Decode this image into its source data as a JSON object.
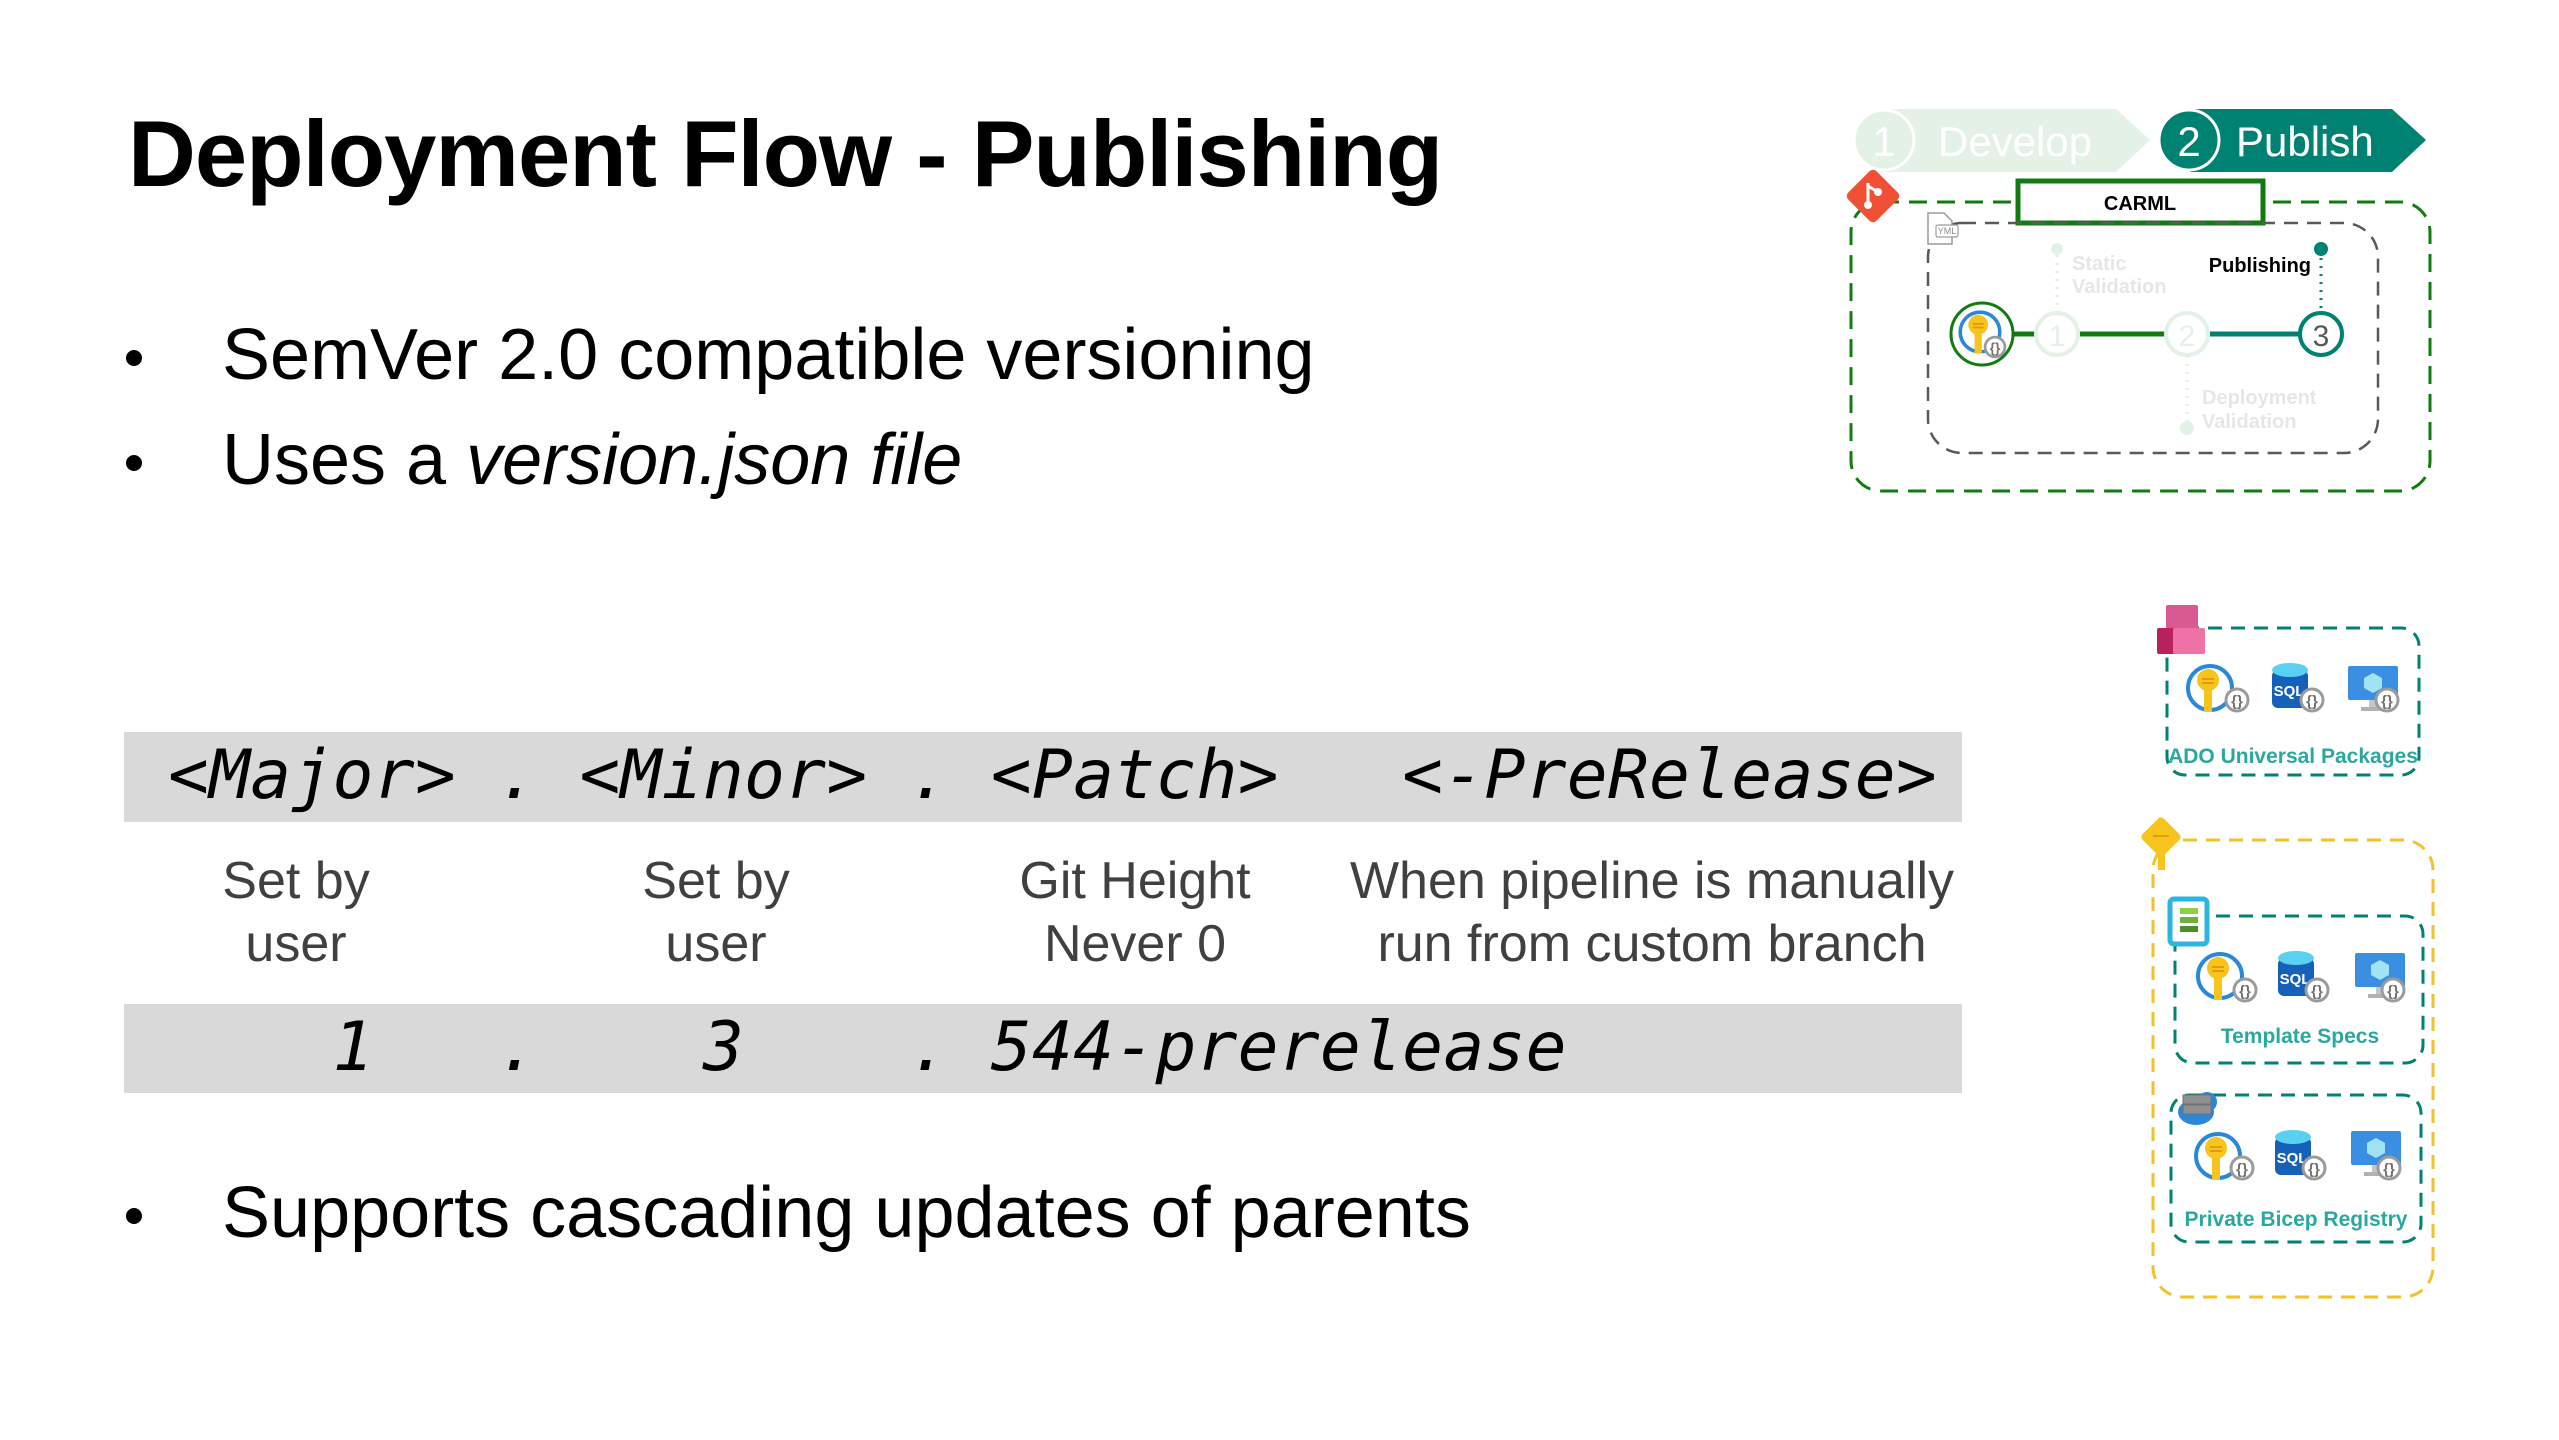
{
  "slide": {
    "title": "Deployment Flow - Publishing",
    "bullets": [
      {
        "text": "SemVer 2.0 compatible versioning"
      },
      {
        "prefix": "Uses a ",
        "emphasis": "version.json file"
      },
      {
        "text": "Supports cascading updates of parents"
      }
    ]
  },
  "version_table": {
    "header_line": "<Major> . <Minor> . <Patch>   <-PreRelease>",
    "descriptions": [
      {
        "line1": "Set by",
        "line2": "user"
      },
      {
        "line1": "Set by",
        "line2": "user"
      },
      {
        "line1": "Git Height",
        "line2": "Never 0"
      },
      {
        "line1": "When pipeline is manually",
        "line2": "run from custom branch"
      }
    ],
    "example_line": "    1   .    3    . 544-prerelease",
    "example": {
      "major": "1",
      "minor": "3",
      "patch_prerelease": "544-prerelease"
    }
  },
  "flow_diagram": {
    "stages": [
      {
        "number": "1",
        "label": "Develop",
        "state": "inactive"
      },
      {
        "number": "2",
        "label": "Publish",
        "state": "active"
      }
    ],
    "repo_label": "CARML",
    "pipeline_file_badge": "YML",
    "steps": [
      {
        "number": "1",
        "label_line1": "Static",
        "label_line2": "Validation",
        "state": "inactive"
      },
      {
        "number": "2",
        "label_line1": "Deployment",
        "label_line2": "Validation",
        "state": "inactive"
      },
      {
        "number": "3",
        "label_line1": "Publishing",
        "label_line2": "",
        "state": "active"
      }
    ]
  },
  "targets": {
    "ado": {
      "label": "ADO Universal Packages",
      "icons": [
        "key-vault-icon",
        "sql-database-icon",
        "virtual-machine-icon"
      ]
    },
    "template_specs": {
      "label": "Template Specs",
      "icons": [
        "key-vault-icon",
        "sql-database-icon",
        "virtual-machine-icon"
      ]
    },
    "bicep_registry": {
      "label": "Private Bicep Registry",
      "icons": [
        "key-vault-icon",
        "sql-database-icon",
        "virtual-machine-icon"
      ]
    },
    "sql_badge": "SQL",
    "braces": "{}"
  },
  "colors": {
    "teal": "#008272",
    "green": "#107C10",
    "inactive": "#E3F1E7",
    "gray_band": "#D9D9D9",
    "label_teal": "#2AA8A0",
    "yellow": "#F2C12E",
    "git_orange": "#F05033"
  }
}
